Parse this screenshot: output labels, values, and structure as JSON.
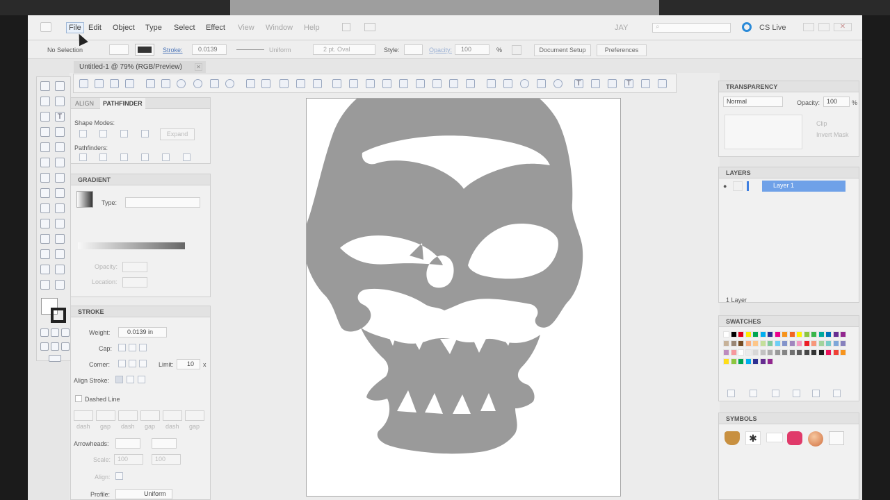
{
  "menubar": {
    "items": [
      "File",
      "Edit",
      "Object",
      "Type",
      "Select",
      "Effect",
      "View",
      "Window",
      "Help"
    ],
    "workspace": "JAY",
    "cslive": "CS Live"
  },
  "control_bar": {
    "selection": "No Selection",
    "stroke_label": "Stroke:",
    "stroke_value": "0.0139",
    "stroke_style": "Uniform",
    "brush": "2 pt. Oval",
    "style_label": "Style:",
    "opacity_label": "Opacity:",
    "opacity_value": "100",
    "opacity_unit": "%",
    "document_setup": "Document Setup",
    "preferences": "Preferences"
  },
  "document": {
    "tab_title": "Untitled-1 @ 79% (RGB/Preview)"
  },
  "align_panel": {
    "tabs": [
      "ALIGN",
      "PATHFINDER"
    ],
    "shape_modes": "Shape Modes:",
    "expand": "Expand",
    "pathfinders": "Pathfinders:"
  },
  "gradient_panel": {
    "title": "GRADIENT",
    "type_label": "Type:",
    "opacity_label": "Opacity:",
    "location_label": "Location:"
  },
  "stroke_panel": {
    "title": "STROKE",
    "weight_label": "Weight:",
    "weight_value": "0.0139 in",
    "cap_label": "Cap:",
    "corner_label": "Corner:",
    "limit_label": "Limit:",
    "limit_value": "10",
    "limit_unit": "x",
    "align_label": "Align Stroke:",
    "dashed_label": "Dashed Line",
    "dash_labels": [
      "dash",
      "gap",
      "dash",
      "gap",
      "dash",
      "gap"
    ],
    "arrowheads_label": "Arrowheads:",
    "scale_label": "Scale:",
    "scale_values": [
      "100",
      "100"
    ],
    "align2_label": "Align:",
    "profile_label": "Profile:",
    "profile_value": "Uniform"
  },
  "transparency_panel": {
    "title": "TRANSPARENCY",
    "mode": "Normal",
    "opacity_label": "Opacity:",
    "opacity_value": "100",
    "opacity_unit": "%",
    "clip": "Clip",
    "invert": "Invert Mask"
  },
  "layers_panel": {
    "title": "LAYERS",
    "layer_name": "Layer 1",
    "count": "1 Layer"
  },
  "swatches_panel": {
    "title": "SWATCHES",
    "colors": [
      "#ffffff",
      "#000000",
      "#e3001b",
      "#ffec00",
      "#00a651",
      "#00aeef",
      "#2e3192",
      "#ec008c",
      "#f7941d",
      "#f26522",
      "#fff200",
      "#8dc63f",
      "#39b54a",
      "#00a99d",
      "#0072bc",
      "#662d91",
      "#92278f",
      "#c7b299",
      "#998675",
      "#754c24",
      "#f9ad81",
      "#fdc689",
      "#c4df9b",
      "#82ca9c",
      "#6dcff6",
      "#8393ca",
      "#a186be",
      "#f49ac1",
      "#ed1c24",
      "#f7977a",
      "#a3d39c",
      "#7accc8",
      "#7da7d9",
      "#8781bd",
      "#bd8cbf",
      "#f6989d",
      "#ffffff",
      "#ebebeb",
      "#d7d7d7",
      "#c2c2c2",
      "#adadad",
      "#999999",
      "#858585",
      "#707070",
      "#5c5c5c",
      "#474747",
      "#333333",
      "#1f1f1f",
      "#ed145b",
      "#ef4136",
      "#f7941d",
      "#ffde17",
      "#8dc63f",
      "#00a651",
      "#00aeef",
      "#2e3192",
      "#662d91",
      "#92278f"
    ]
  },
  "symbols_panel": {
    "title": "SYMBOLS"
  }
}
